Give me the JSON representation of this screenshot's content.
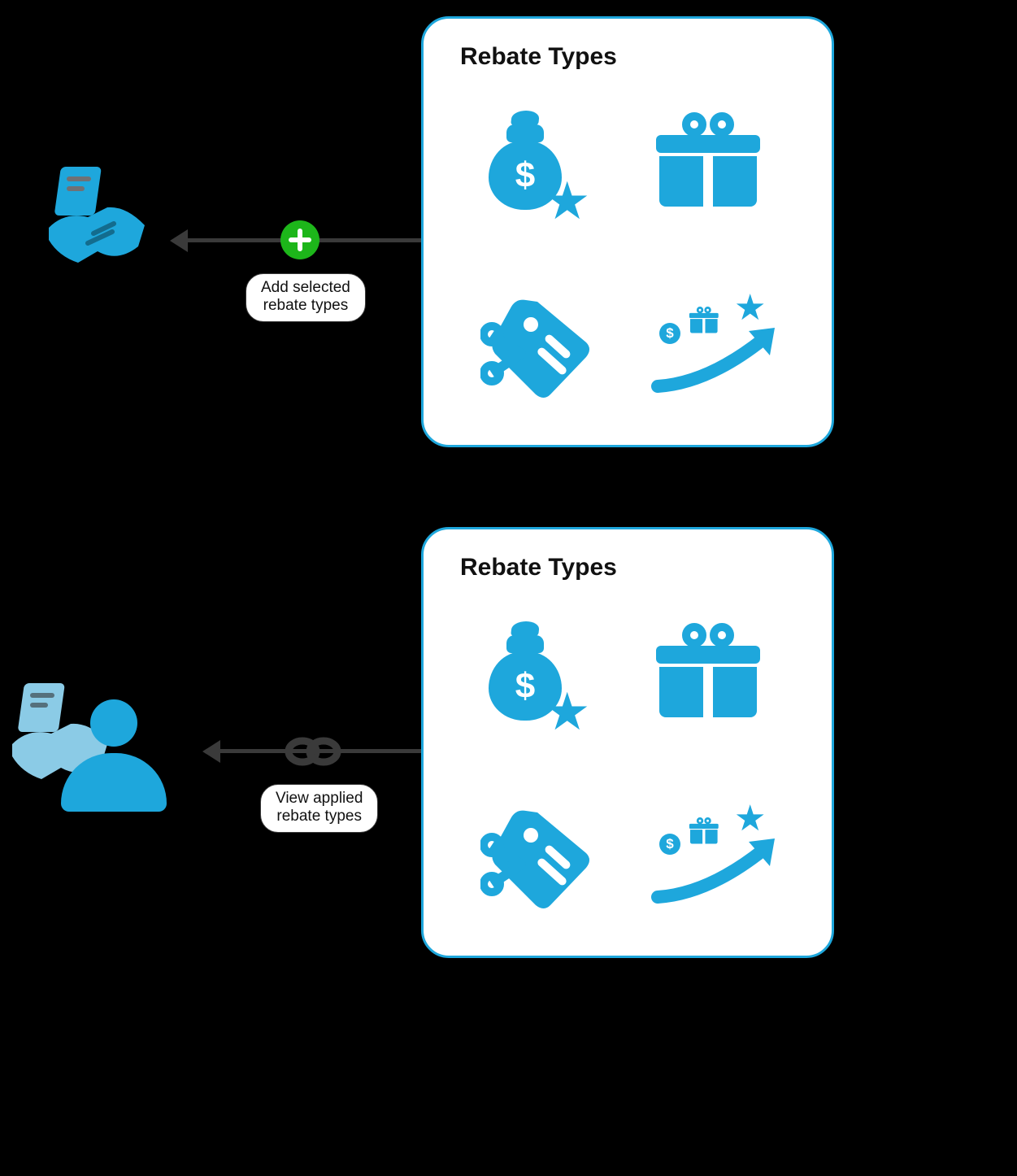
{
  "colors": {
    "primary": "#1ea7dc",
    "primary_light": "#8bcbe6",
    "action_add": "#1db61a",
    "connector": "#3a3a3a"
  },
  "nodes": {
    "contract": {
      "icon": "contract-handshake"
    },
    "partner_contract": {
      "icon": "contract-handshake-person"
    }
  },
  "connectors": {
    "add": {
      "badge_icon": "plus",
      "label_line1": "Add selected",
      "label_line2": "rebate types"
    },
    "view": {
      "badge_icon": "link",
      "label_line1": "View applied",
      "label_line2": "rebate types"
    }
  },
  "panels": {
    "top": {
      "title": "Rebate Types",
      "items": [
        {
          "icon": "money-bag-star"
        },
        {
          "icon": "gift"
        },
        {
          "icon": "discount-tag"
        },
        {
          "icon": "growth-rewards"
        }
      ]
    },
    "bottom": {
      "title": "Rebate Types",
      "items": [
        {
          "icon": "money-bag-star"
        },
        {
          "icon": "gift"
        },
        {
          "icon": "discount-tag"
        },
        {
          "icon": "growth-rewards"
        }
      ]
    }
  }
}
